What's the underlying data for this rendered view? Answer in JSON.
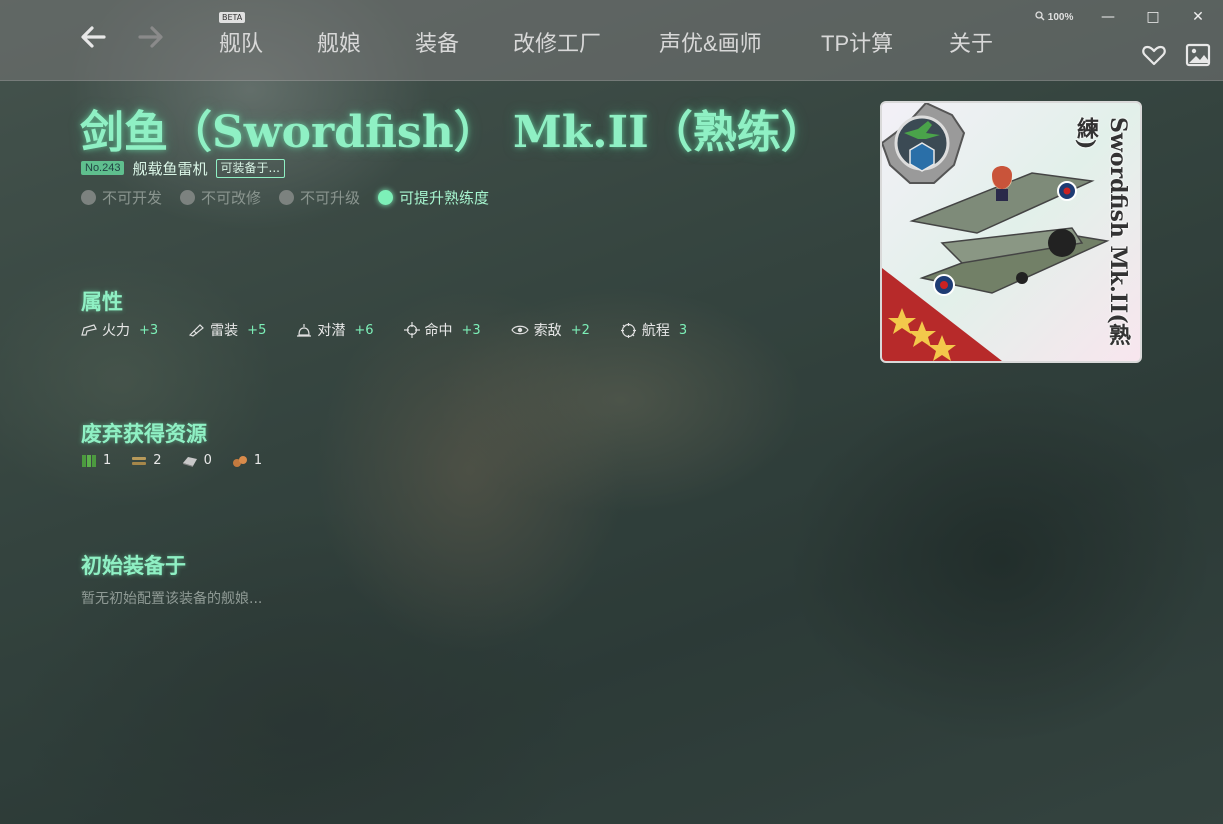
{
  "nav": {
    "back_icon": "arrow-left-icon",
    "forward_icon": "arrow-right-icon",
    "beta_badge": "BETA",
    "items": [
      {
        "label": "舰队"
      },
      {
        "label": "舰娘"
      },
      {
        "label": "装备"
      },
      {
        "label": "改修工厂"
      },
      {
        "label": "声优&画师"
      },
      {
        "label": "TP计算"
      },
      {
        "label": "关于"
      }
    ]
  },
  "window": {
    "zoom": "100%",
    "minimize": "—",
    "maximize": "□",
    "close": "✕",
    "favorite_icon": "heart-icon",
    "image_icon": "image-icon"
  },
  "equipment": {
    "title": "剑鱼（Swordfish） Mk.II（熟练）",
    "number": "No.243",
    "type": "舰载鱼雷机",
    "equippable_label": "可装备于...",
    "flags": [
      {
        "label": "不可开发",
        "active": false
      },
      {
        "label": "不可改修",
        "active": false
      },
      {
        "label": "不可升级",
        "active": false
      },
      {
        "label": "可提升熟练度",
        "active": true
      }
    ],
    "card_name": "Swordfish Mk.II(熟練)",
    "accent_color": "#8ff0c4"
  },
  "stats_section": {
    "title": "属性",
    "items": [
      {
        "icon": "firepower-icon",
        "label": "火力",
        "value": "+3"
      },
      {
        "icon": "torpedo-icon",
        "label": "雷装",
        "value": "+5"
      },
      {
        "icon": "asw-icon",
        "label": "对潜",
        "value": "+6"
      },
      {
        "icon": "accuracy-icon",
        "label": "命中",
        "value": "+3"
      },
      {
        "icon": "los-icon",
        "label": "索敌",
        "value": "+2"
      },
      {
        "icon": "range-icon",
        "label": "航程",
        "value": "3"
      }
    ]
  },
  "scrap_section": {
    "title": "废弃获得资源",
    "items": [
      {
        "icon": "fuel-icon",
        "value": "1"
      },
      {
        "icon": "ammo-icon",
        "value": "2"
      },
      {
        "icon": "steel-icon",
        "value": "0"
      },
      {
        "icon": "bauxite-icon",
        "value": "1"
      }
    ]
  },
  "initial_section": {
    "title": "初始装备于",
    "empty_text": "暂无初始配置该装备的舰娘..."
  }
}
